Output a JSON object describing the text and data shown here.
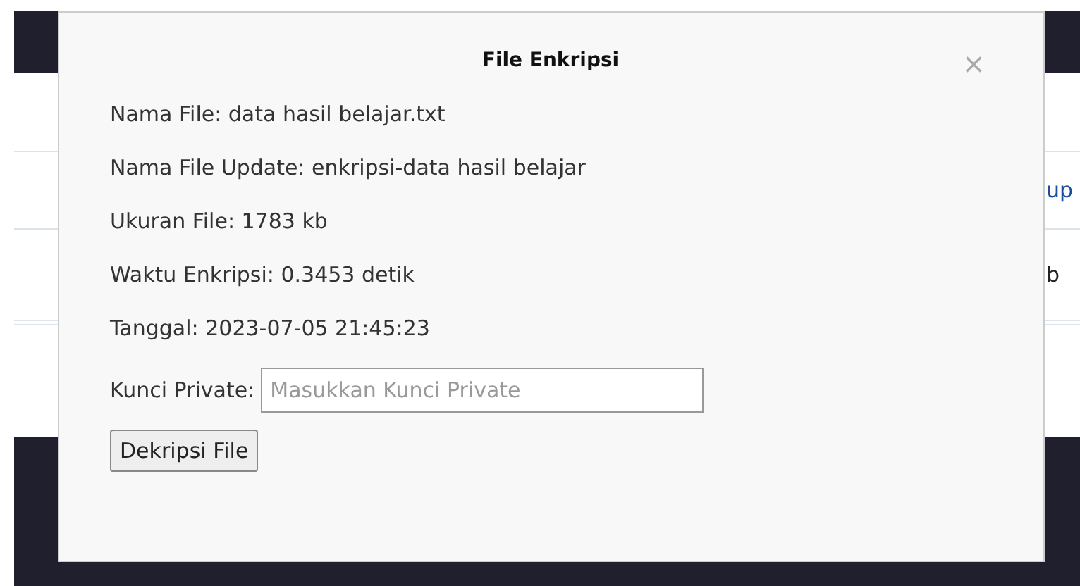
{
  "background_table": {
    "rows": [
      {
        "column_3": "up"
      },
      {
        "column_3": "b"
      }
    ]
  },
  "dialog": {
    "title": "File Enkripsi",
    "close": "×",
    "lines": [
      "Nama File: data hasil belajar.txt",
      "Nama File Update: enkripsi-data hasil belajar",
      "Ukuran File: 1783 kb",
      "Waktu Enkripsi: 0.3453 detik",
      "Tanggal: 2023-07-05 21:45:23"
    ],
    "key_label": "Kunci Private:",
    "key_field": {
      "placeholder": "Masukkan Kunci Private"
    },
    "button": "Dekripsi File"
  }
}
